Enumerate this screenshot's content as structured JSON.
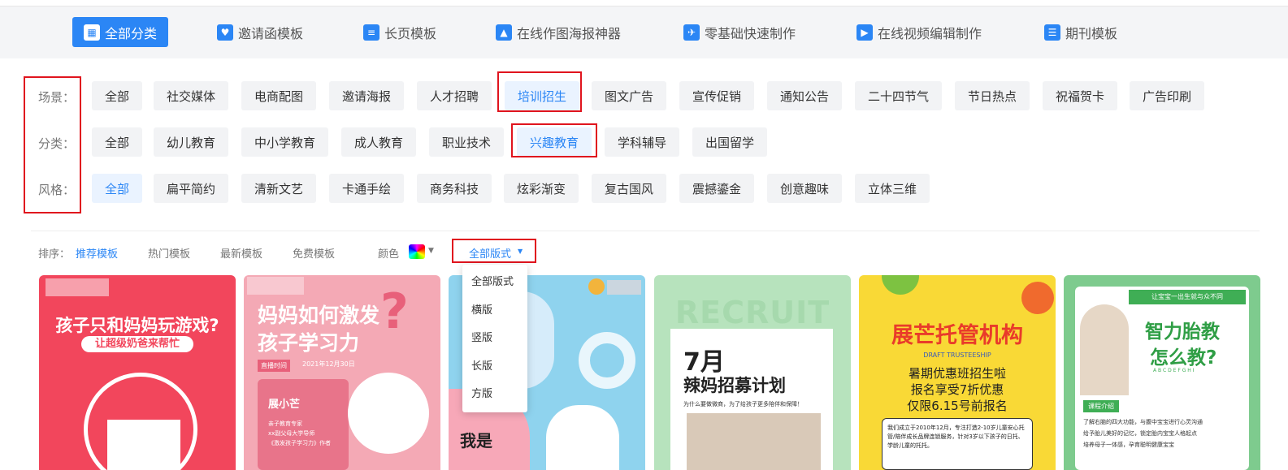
{
  "nav": {
    "items": [
      {
        "label": "全部分类",
        "icon": "grid-icon",
        "active": true
      },
      {
        "label": "邀请函模板",
        "icon": "heart-envelope-icon"
      },
      {
        "label": "长页模板",
        "icon": "document-icon"
      },
      {
        "label": "在线作图海报神器",
        "icon": "image-icon"
      },
      {
        "label": "零基础快速制作",
        "icon": "rocket-icon"
      },
      {
        "label": "在线视频编辑制作",
        "icon": "film-icon"
      },
      {
        "label": "期刊模板",
        "icon": "list-icon"
      }
    ]
  },
  "filters": {
    "scene_label": "场景：",
    "category_label": "分类：",
    "style_label": "风格：",
    "scene": [
      "全部",
      "社交媒体",
      "电商配图",
      "邀请海报",
      "人才招聘",
      "培训招生",
      "图文广告",
      "宣传促销",
      "通知公告",
      "二十四节气",
      "节日热点",
      "祝福贺卡",
      "广告印刷"
    ],
    "category": [
      "全部",
      "幼儿教育",
      "中小学教育",
      "成人教育",
      "职业技术",
      "兴趣教育",
      "学科辅导",
      "出国留学"
    ],
    "style": [
      "全部",
      "扁平简约",
      "清新文艺",
      "卡通手绘",
      "商务科技",
      "炫彩渐变",
      "复古国风",
      "震撼鎏金",
      "创意趣味",
      "立体三维"
    ]
  },
  "sort": {
    "label": "排序：",
    "options": [
      "推荐模板",
      "热门模板",
      "最新模板",
      "免费模板"
    ],
    "color_label": "颜色",
    "layout_label": "全部版式"
  },
  "dropdown": [
    "全部版式",
    "横版",
    "竖版",
    "长版",
    "方版"
  ],
  "cards": [
    {
      "title": "孩子只和妈妈玩游戏?",
      "subtitle": "让超级奶爸来帮忙"
    },
    {
      "title": "妈妈如何激发",
      "title2": "孩子学习力",
      "tag": "直播时间",
      "date": "2021年12月30日",
      "name": "展小芒",
      "bullets": [
        "亲子教育专家",
        "xx副父母大学导师",
        "《激发孩子学习力》作者"
      ]
    },
    {
      "title": "我是"
    },
    {
      "bg_text": "RECRUIT",
      "title": "7月",
      "title2": "辣妈招募计划",
      "sub": "为什么要做微商，为了给孩子更多陪伴和保障！"
    },
    {
      "title": "展芒托管机构",
      "sub_en": "DRAFT TRUSTEESHIP",
      "l1": "暑期优惠班招生啦",
      "l2": "报名享受7折优惠",
      "l3": "仅限6.15号前报名",
      "body": "我们成立于2010年12月，专注打造2-10岁儿童安心托管/陪伴成长品牌连锁服务，针对3岁以下孩子的日托、学龄儿童的托托。"
    },
    {
      "top": "让宝宝一出生就与众不同",
      "title": "智力胎教",
      "title2": "怎么教?",
      "abc": "A B C D E F G H I",
      "section": "课程介绍",
      "bullets": [
        "了解右脑的四大功能，与腹中宝宝进行心灵沟通",
        "给予胎儿美好的记忆，锁定胎内宝宝人格起点",
        "培养母子一体感，孕育聪明健康宝宝"
      ]
    }
  ],
  "colors": {
    "accent": "#2b86f5",
    "highlight": "#e0141e"
  }
}
